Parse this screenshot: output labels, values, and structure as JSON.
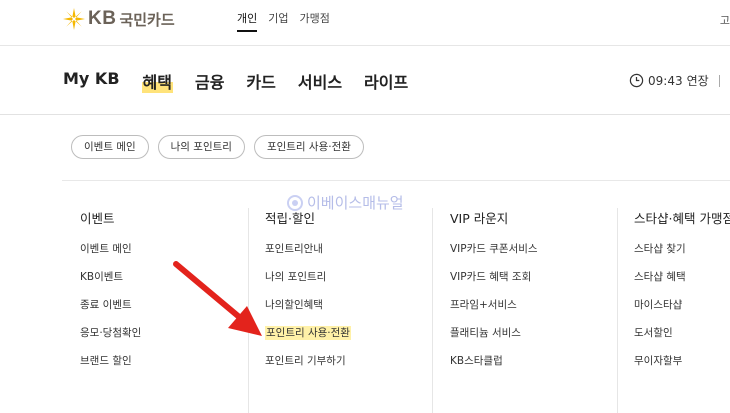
{
  "header": {
    "logo_kb": "KB",
    "logo_name": "국민카드",
    "top_nav": [
      "개인",
      "기업",
      "가맹점"
    ],
    "top_right": "고"
  },
  "gnb": {
    "items": [
      "My KB",
      "혜택",
      "금융",
      "카드",
      "서비스",
      "라이프"
    ],
    "active_index": 1,
    "clock_time": "09:43",
    "extend_label": "연장"
  },
  "subtabs": [
    "이벤트 메인",
    "나의 포인트리",
    "포인트리 사용·전환"
  ],
  "watermark": "이베이스매뉴얼",
  "columns": [
    {
      "heading": "이벤트",
      "items": [
        "이벤트 메인",
        "KB이벤트",
        "종료 이벤트",
        "응모·당첨확인",
        "브랜드 할인"
      ]
    },
    {
      "heading": "적립·할인",
      "items": [
        "포인트리안내",
        "나의 포인트리",
        "나의할인혜택",
        "포인트리 사용·전환",
        "포인트리 기부하기"
      ],
      "highlight_index": 3
    },
    {
      "heading": "VIP 라운지",
      "items": [
        "VIP카드 쿠폰서비스",
        "VIP카드 혜택 조회",
        "프라임+서비스",
        "플래티늄 서비스",
        "KB스타클럽"
      ]
    },
    {
      "heading": "스타샵·혜택 가맹점",
      "items": [
        "스타샵 찾기",
        "스타샵 혜택",
        "마이스타샵",
        "도서할인",
        "무이자할부"
      ]
    }
  ],
  "colors": {
    "accent_yellow": "#ffe37a",
    "highlight": "#fff1a8",
    "arrow_red": "#e3231c",
    "logo_gold": "#f5b800"
  }
}
